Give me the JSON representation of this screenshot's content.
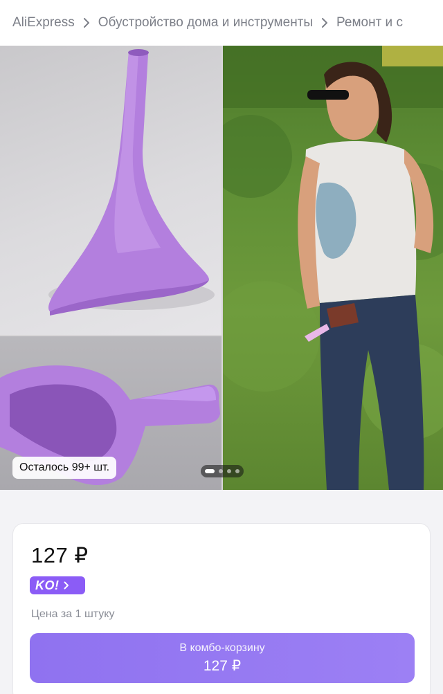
{
  "breadcrumb": {
    "items": [
      "AliExpress",
      "Обустройство дома и инструменты",
      "Ремонт и с"
    ]
  },
  "gallery": {
    "stock_label": "Осталось 99+ шт.",
    "pager": {
      "count": 4,
      "active_index": 0
    }
  },
  "price_card": {
    "price": "127 ₽",
    "ko_label": "KO!",
    "unit_note": "Цена за 1 штуку",
    "combo_button": {
      "label": "В комбо-корзину",
      "price": "127 ₽"
    }
  },
  "colors": {
    "accent_purple": "#8b5cf6",
    "product_lilac": "#b37fde",
    "breadcrumb_text": "#7c7f88"
  }
}
